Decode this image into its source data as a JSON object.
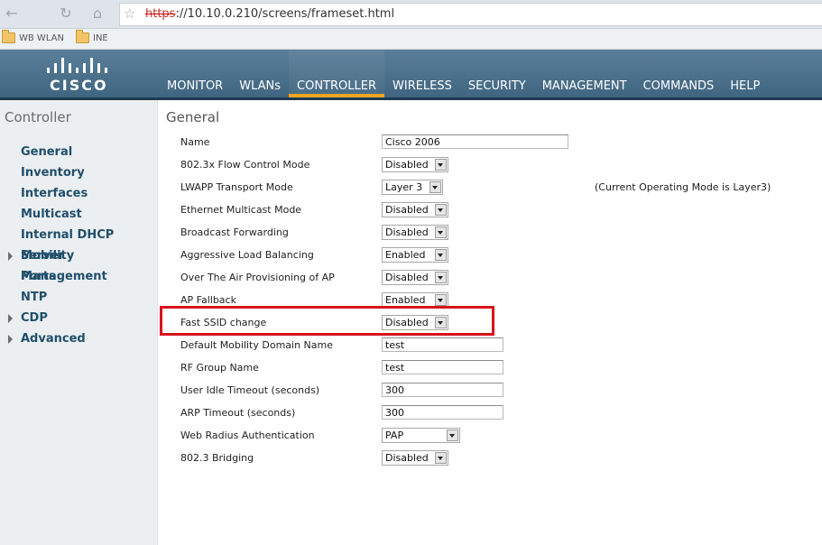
{
  "browser": {
    "url_protocol": "https",
    "url_rest": "://10.10.0.210/screens/frameset.html",
    "bookmarks": [
      "WB WLAN",
      "INE"
    ]
  },
  "header": {
    "logo": "CISCO",
    "menu": [
      {
        "label": "MONITOR",
        "active": false
      },
      {
        "label": "WLANs",
        "active": false
      },
      {
        "label": "CONTROLLER",
        "active": true
      },
      {
        "label": "WIRELESS",
        "active": false
      },
      {
        "label": "SECURITY",
        "active": false
      },
      {
        "label": "MANAGEMENT",
        "active": false
      },
      {
        "label": "COMMANDS",
        "active": false
      },
      {
        "label": "HELP",
        "active": false
      }
    ]
  },
  "sidebar": {
    "title": "Controller",
    "items": [
      {
        "label": "General",
        "expandable": false
      },
      {
        "label": "Inventory",
        "expandable": false
      },
      {
        "label": "Interfaces",
        "expandable": false
      },
      {
        "label": "Multicast",
        "expandable": false
      },
      {
        "label": "Internal DHCP Server",
        "expandable": false
      },
      {
        "label": "Mobility Management",
        "expandable": true
      },
      {
        "label": "Ports",
        "expandable": false
      },
      {
        "label": "NTP",
        "expandable": false
      },
      {
        "label": "CDP",
        "expandable": true
      },
      {
        "label": "Advanced",
        "expandable": true
      }
    ]
  },
  "main": {
    "title": "General",
    "note": "(Current Operating Mode is Layer3)",
    "rows": [
      {
        "label": "Name",
        "kind": "text",
        "value": "Cisco 2006"
      },
      {
        "label": "802.3x Flow Control Mode",
        "kind": "select",
        "value": "Disabled"
      },
      {
        "label": "LWAPP Transport Mode",
        "kind": "select",
        "value": "Layer 3"
      },
      {
        "label": "Ethernet Multicast Mode",
        "kind": "select",
        "value": "Disabled"
      },
      {
        "label": "Broadcast Forwarding",
        "kind": "select",
        "value": "Disabled"
      },
      {
        "label": "Aggressive Load Balancing",
        "kind": "select",
        "value": "Enabled"
      },
      {
        "label": "Over The Air Provisioning of AP",
        "kind": "select",
        "value": "Disabled"
      },
      {
        "label": "AP Fallback",
        "kind": "select",
        "value": "Enabled"
      },
      {
        "label": "Fast SSID change",
        "kind": "select",
        "value": "Disabled"
      },
      {
        "label": "Default Mobility Domain Name",
        "kind": "text",
        "value": "test"
      },
      {
        "label": "RF Group Name",
        "kind": "text",
        "value": "test"
      },
      {
        "label": "User Idle Timeout (seconds)",
        "kind": "text",
        "value": "300"
      },
      {
        "label": "ARP Timeout (seconds)",
        "kind": "text",
        "value": "300"
      },
      {
        "label": "Web Radius Authentication",
        "kind": "select",
        "value": "PAP"
      },
      {
        "label": "802.3 Bridging",
        "kind": "select",
        "value": "Disabled"
      }
    ]
  },
  "colors": {
    "highlight": "#d8141b",
    "active_tab": "#f5a623",
    "sidebar_link": "#1f4f6b"
  }
}
